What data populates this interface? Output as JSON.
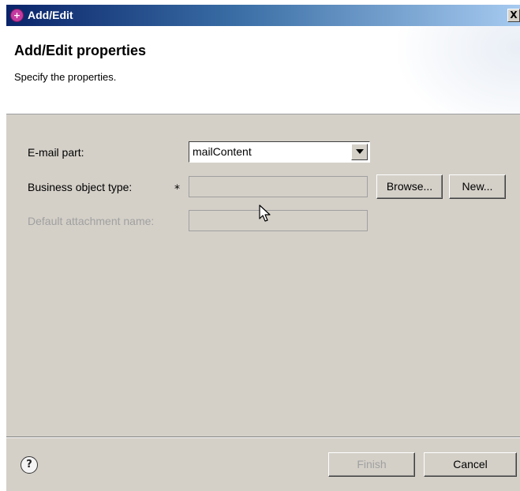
{
  "window": {
    "title": "Add/Edit",
    "close_glyph": "X"
  },
  "header": {
    "title": "Add/Edit properties",
    "description": "Specify the properties."
  },
  "form": {
    "email_part": {
      "label": "E-mail part:",
      "value": "mailContent"
    },
    "business_object_type": {
      "label": "Business object type:",
      "required_mark": "*",
      "value": ""
    },
    "default_attachment_name": {
      "label": "Default attachment name:",
      "value": ""
    },
    "browse_label": "Browse...",
    "new_label": "New..."
  },
  "footer": {
    "help_glyph": "?",
    "finish_label": "Finish",
    "cancel_label": "Cancel"
  },
  "colors": {
    "title_bar_start": "#0a246a",
    "title_bar_end": "#a6caf0",
    "dialog_background": "#d4d0c8",
    "disabled_text": "#a0a0a0"
  },
  "icons": [
    "app-icon",
    "close-icon",
    "dropdown-arrow-icon",
    "help-icon",
    "mouse-cursor-icon"
  ]
}
